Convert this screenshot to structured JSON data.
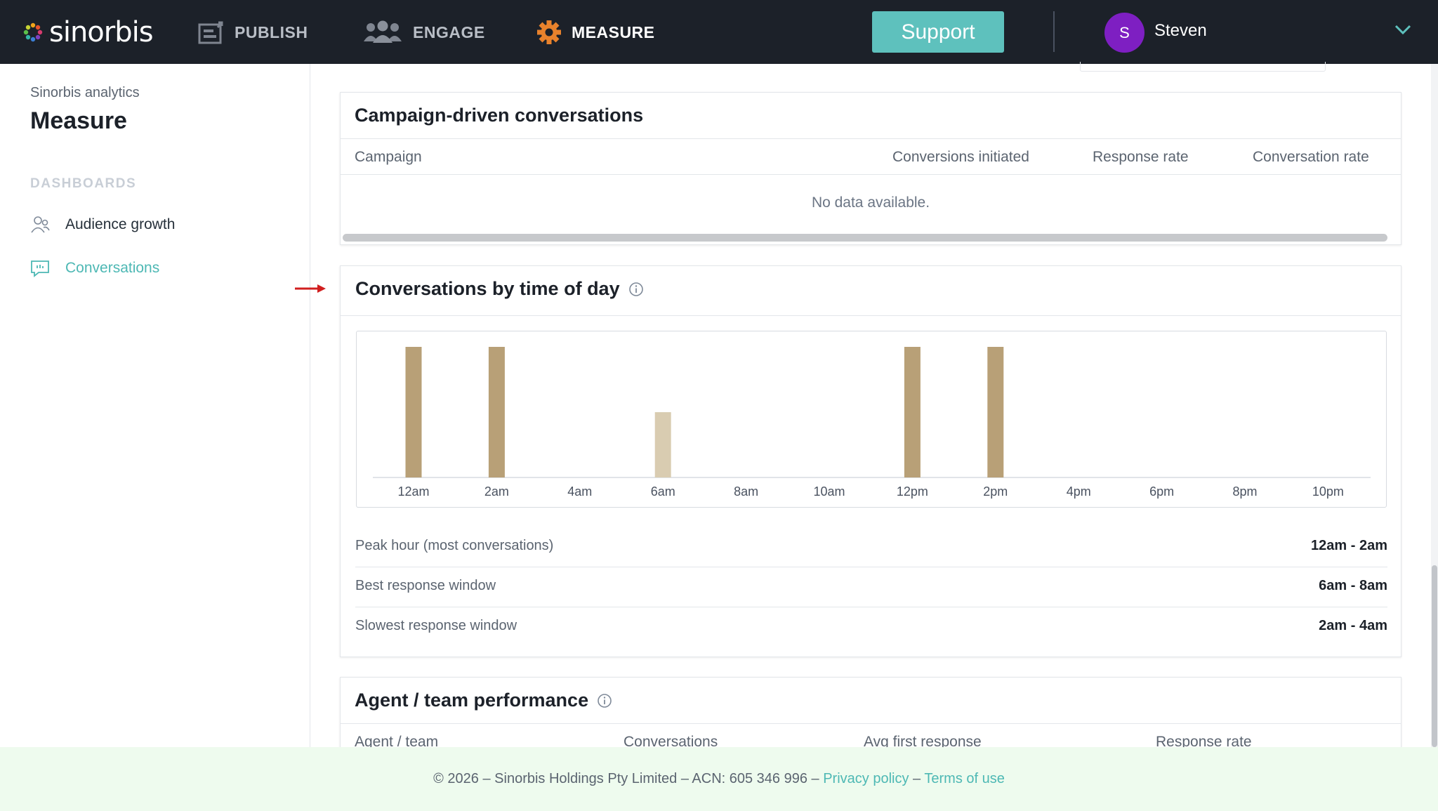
{
  "header": {
    "logo_text": "sinorbis",
    "nav": [
      {
        "label": "PUBLISH",
        "icon": "publish-icon"
      },
      {
        "label": "ENGAGE",
        "icon": "people-icon"
      },
      {
        "label": "MEASURE",
        "icon": "gear-icon"
      }
    ],
    "active_nav": "MEASURE",
    "support_label": "Support",
    "user_initial": "S",
    "user_name": "Steven",
    "colors": {
      "bar_bg": "#1c2129",
      "accent": "#5ec1bd",
      "avatar": "#7e1fc2"
    }
  },
  "sidebar": {
    "subtitle": "Sinorbis analytics",
    "title": "Measure",
    "section_label": "DASHBOARDS",
    "items": [
      {
        "label": "Audience growth",
        "icon": "audience-icon",
        "active": false
      },
      {
        "label": "Conversations",
        "icon": "chat-icon",
        "active": true
      }
    ]
  },
  "campaign_card": {
    "title": "Campaign-driven conversations",
    "columns": [
      "Campaign",
      "Conversions initiated",
      "Response rate",
      "Conversation rate"
    ],
    "empty_text": "No data available."
  },
  "time_card": {
    "title": "Conversations by time of day",
    "stats": [
      {
        "label": "Peak hour (most conversations)",
        "value": "12am - 2am"
      },
      {
        "label": "Best response window",
        "value": "6am - 8am"
      },
      {
        "label": "Slowest response window",
        "value": "2am - 4am"
      }
    ]
  },
  "agent_card": {
    "title": "Agent / team performance",
    "columns": [
      "Agent / team",
      "Conversations",
      "Avg first response",
      "Response rate"
    ]
  },
  "chart_data": {
    "type": "bar",
    "categories": [
      "12am",
      "2am",
      "4am",
      "6am",
      "8am",
      "10am",
      "12pm",
      "2pm",
      "4pm",
      "6pm",
      "8pm",
      "10pm"
    ],
    "values": [
      1,
      1,
      0,
      0.5,
      0,
      0,
      1,
      1,
      0,
      0,
      0,
      0
    ],
    "highlight": [
      true,
      true,
      false,
      false,
      false,
      false,
      true,
      true,
      false,
      false,
      false,
      false
    ],
    "ylim": [
      0,
      1
    ],
    "grid": false,
    "colors": {
      "bar": "#b8a077",
      "bar_light": "#d9ccb1"
    }
  },
  "footer": {
    "text": "© 2026 – Sinorbis Holdings Pty Limited – ACN: 605 346 996 –",
    "privacy_label": "Privacy policy",
    "separator": "–",
    "terms_label": "Terms of use"
  }
}
